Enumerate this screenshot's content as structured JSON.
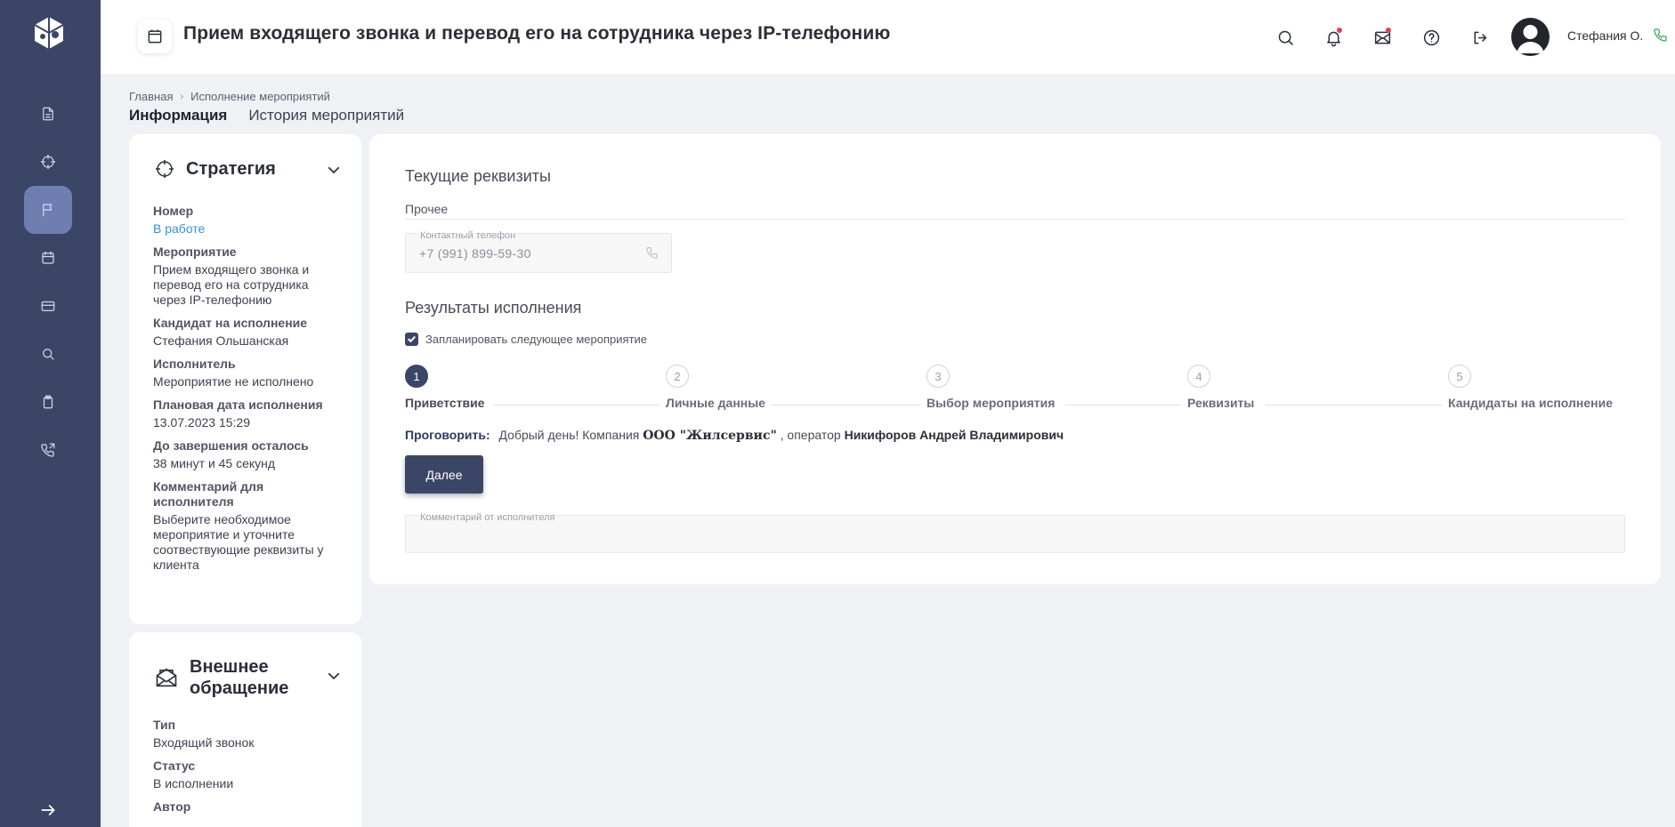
{
  "header": {
    "title": "Прием входящего звонка и перевод его на сотрудника через IP-телефонию",
    "user_name": "Стефания О."
  },
  "breadcrumb": [
    "Главная",
    "Исполнение мероприятий"
  ],
  "tabs": [
    {
      "label": "Информация",
      "active": true
    },
    {
      "label": "История мероприятий",
      "active": false
    }
  ],
  "sidebar": {
    "items": [
      {
        "icon": "document-icon"
      },
      {
        "icon": "target-icon"
      },
      {
        "icon": "flag-icon",
        "active": true
      },
      {
        "icon": "calendar-icon"
      },
      {
        "icon": "card-icon"
      },
      {
        "icon": "search-icon"
      },
      {
        "icon": "clipboard-icon"
      },
      {
        "icon": "phone-transfer-icon"
      }
    ]
  },
  "strategy": {
    "title": "Стратегия",
    "fields": [
      {
        "label": "Номер",
        "value": "В работе"
      },
      {
        "label": "Мероприятие",
        "value": "Прием входящего звонка и перевод его на сотрудника через IP-телефонию"
      },
      {
        "label": "Кандидат на исполнение",
        "value": "Стефания Ольшанская"
      },
      {
        "label": "Исполнитель",
        "value": "Мероприятие не исполнено"
      },
      {
        "label": "Плановая дата исполнения",
        "value": "13.07.2023 15:29"
      },
      {
        "label": "До завершения осталось",
        "value": "38 минут и 45 секунд"
      },
      {
        "label": "Комментарий для исполнителя",
        "value": "Выберите необходимое мероприятие и уточните соотвествующие реквизиты у клиента"
      }
    ]
  },
  "external": {
    "title": "Внешнее обращение",
    "fields": [
      {
        "label": "Тип",
        "value": "Входящий звонок"
      },
      {
        "label": "Статус",
        "value": "В исполнении"
      },
      {
        "label": "Автор",
        "value": ""
      }
    ]
  },
  "main": {
    "current_title": "Текущие реквизиты",
    "other_label": "Прочее",
    "phone_label": "Контактный телефон",
    "phone_value": "+7 (991) 899-59-30",
    "results_title": "Результаты исполнения",
    "schedule_label": "Запланировать следующее мероприятие",
    "schedule_checked": true,
    "steps": [
      {
        "num": "1",
        "label": "Приветствие",
        "active": true
      },
      {
        "num": "2",
        "label": "Личные данные"
      },
      {
        "num": "3",
        "label": "Выбор мероприятия"
      },
      {
        "num": "4",
        "label": "Реквизиты"
      },
      {
        "num": "5",
        "label": "Кандидаты на исполнение"
      }
    ],
    "speak_label": "Проговорить:",
    "speak_text_1": "Добрый день! Компания",
    "speak_company": "ООО \"Жилсервис\"",
    "speak_text_2": ", оператор",
    "speak_operator": "Никифоров Андрей Владимирович",
    "next_button": "Далее",
    "comment_label": "Комментарий от исполнителя"
  }
}
